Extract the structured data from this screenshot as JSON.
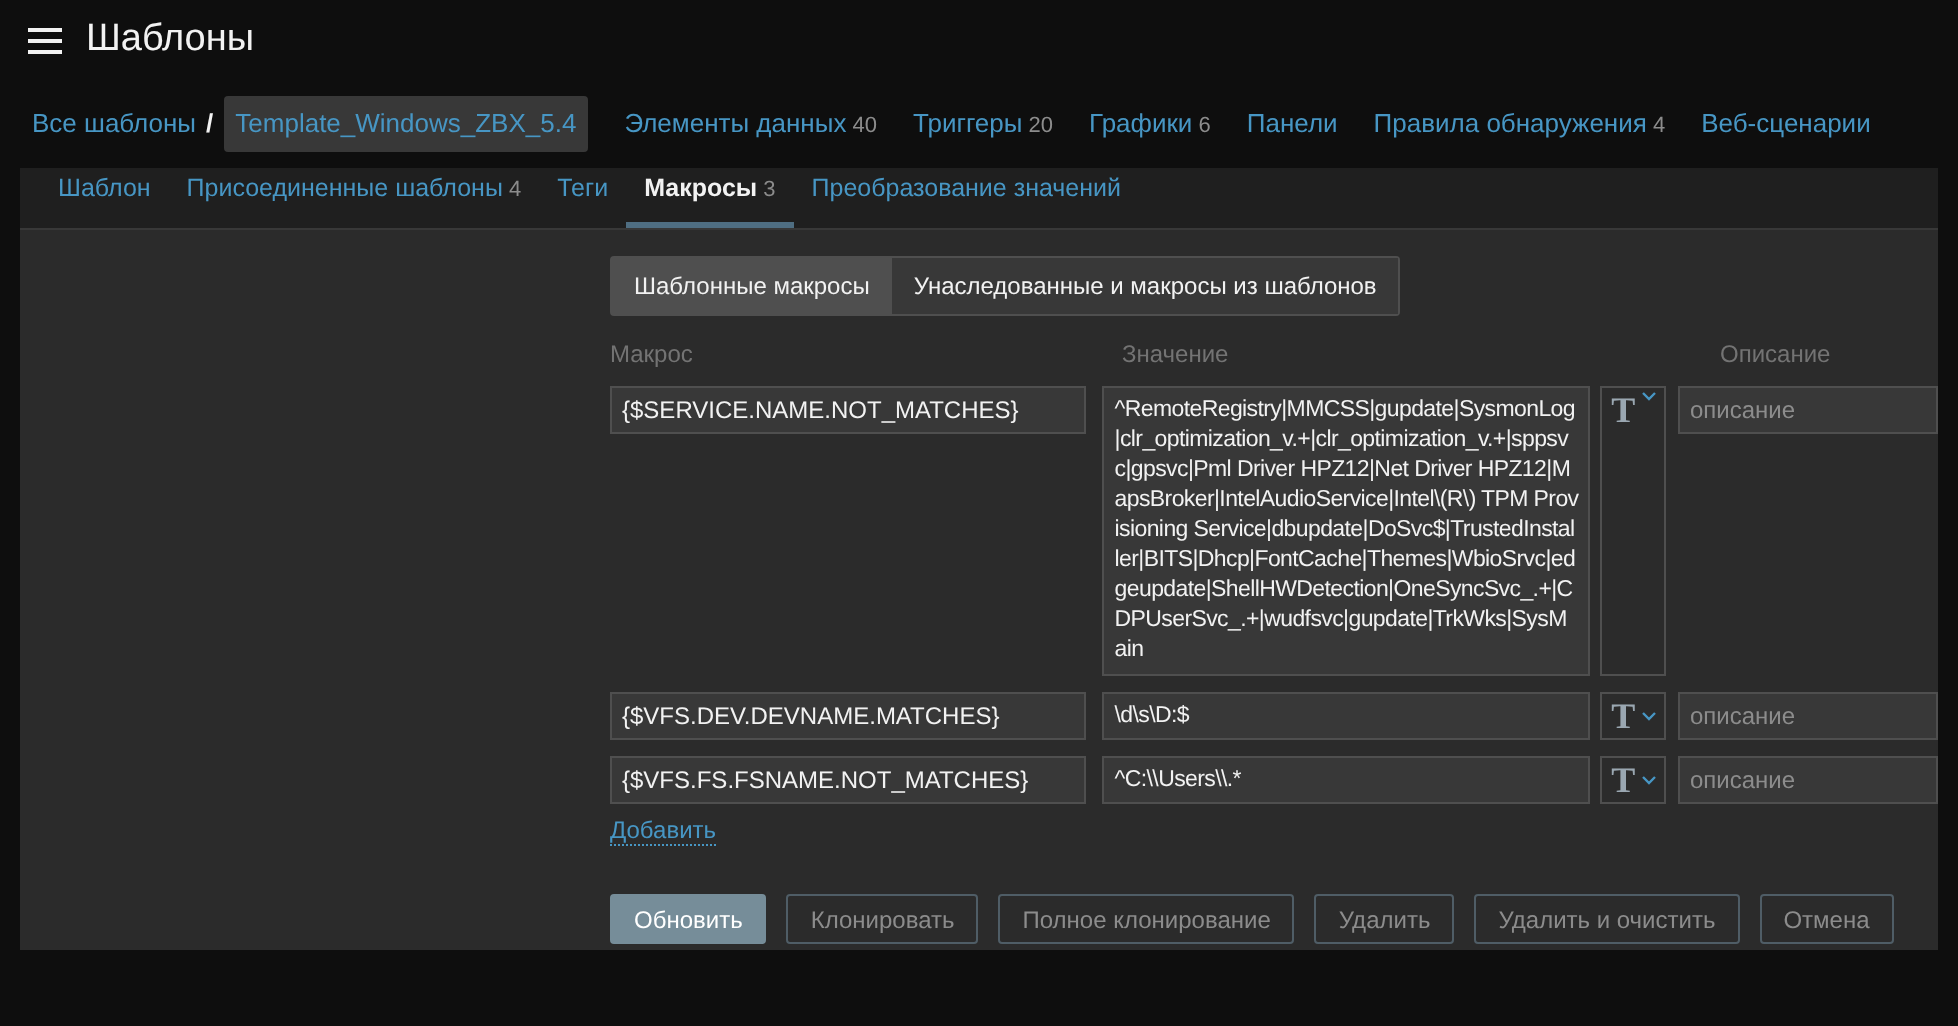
{
  "header": {
    "title": "Шаблоны"
  },
  "breadcrumb_separator": "/",
  "breadcrumbs": [
    {
      "label": "Все шаблоны",
      "current": false
    },
    {
      "label": "Template_Windows_ZBX_5.4",
      "current": true
    },
    {
      "label": "Элементы данных",
      "count": "40",
      "current": false
    },
    {
      "label": "Триггеры",
      "count": "20",
      "current": false
    },
    {
      "label": "Графики",
      "count": "6",
      "current": false
    },
    {
      "label": "Панели",
      "current": false
    },
    {
      "label": "Правила обнаружения",
      "count": "4",
      "current": false
    },
    {
      "label": "Веб-сценарии",
      "current": false
    }
  ],
  "tabs": [
    {
      "label": "Шаблон",
      "selected": false
    },
    {
      "label": "Присоединенные шаблоны",
      "count": "4",
      "selected": false
    },
    {
      "label": "Теги",
      "selected": false
    },
    {
      "label": "Макросы",
      "count": "3",
      "selected": true
    },
    {
      "label": "Преобразование значений",
      "selected": false
    }
  ],
  "macro_tabs": [
    {
      "label": "Шаблонные макросы",
      "selected": true
    },
    {
      "label": "Унаследованные и макросы из шаблонов",
      "selected": false
    }
  ],
  "columns": [
    "Макрос",
    "Значение",
    "Описание"
  ],
  "macros": [
    {
      "macro": "{$SERVICE.NAME.NOT_MATCHES}",
      "value": "^RemoteRegistry|MMCSS|gupdate|SysmonLog|clr_optimization_v.+|clr_optimization_v.+|sppsvc|gpsvc|Pml Driver HPZ12|Net Driver HPZ12|MapsBroker|IntelAudioService|Intel\\(R\\) TPM Provisioning Service|dbupdate|DoSvc$|TrustedInstaller|BITS|Dhcp|FontCache|Themes|WbioSrvc|edgeupdate|ShellHWDetection|OneSyncSvc_.+|CDPUserSvc_.+|wudfsvc|gupdate|TrkWks|SysMain",
      "type_icon": "T",
      "description_placeholder": "описание"
    },
    {
      "macro": "{$VFS.DEV.DEVNAME.MATCHES}",
      "value": "\\d\\s\\D:$",
      "type_icon": "T",
      "description_placeholder": "описание"
    },
    {
      "macro": "{$VFS.FS.FSNAME.NOT_MATCHES}",
      "value": "^C:\\\\Users\\\\.*",
      "type_icon": "T",
      "description_placeholder": "описание"
    }
  ],
  "add_link": "Добавить",
  "buttons": [
    {
      "label": "Обновить",
      "kind": "primary"
    },
    {
      "label": "Клонировать",
      "kind": "secondary"
    },
    {
      "label": "Полное клонирование",
      "kind": "secondary"
    },
    {
      "label": "Удалить",
      "kind": "secondary"
    },
    {
      "label": "Удалить и очистить",
      "kind": "secondary"
    },
    {
      "label": "Отмена",
      "kind": "secondary"
    }
  ]
}
